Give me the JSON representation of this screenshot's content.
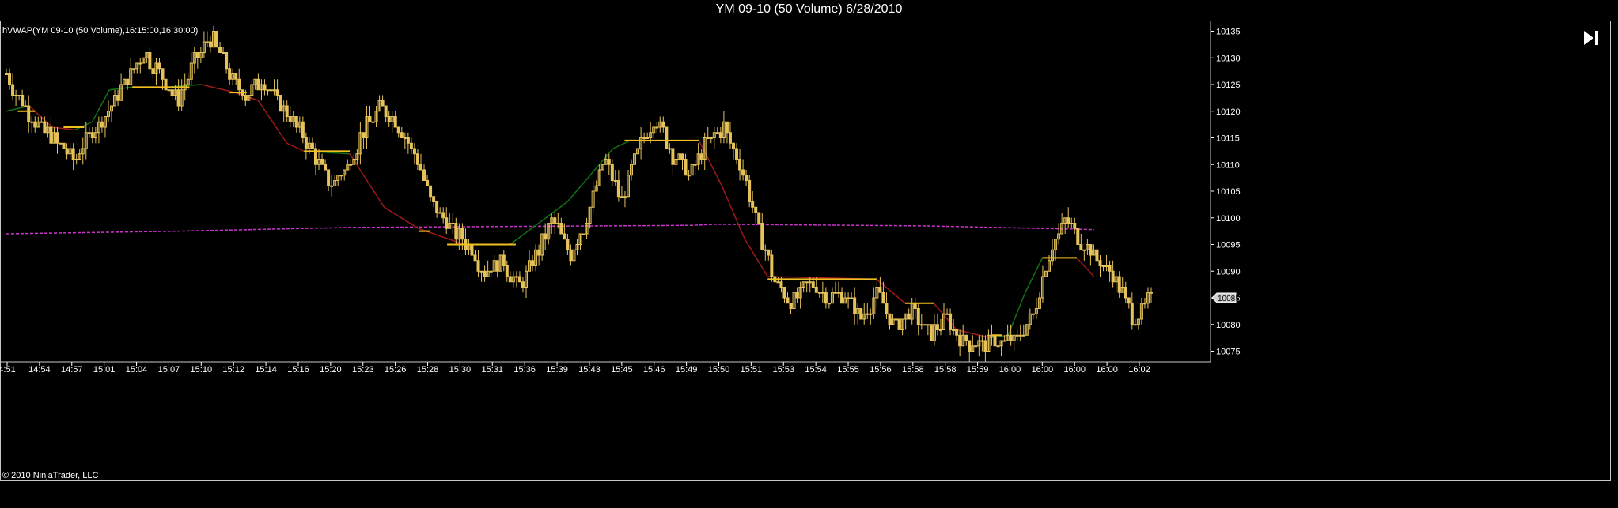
{
  "title": "YM 09-10 (50 Volume)  6/28/2010",
  "indicator_label": "hVWAP(YM 09-10 (50 Volume),16:15:00,16:30:00)",
  "copyright": "© 2010 NinjaTrader, LLC",
  "colors": {
    "background": "#000000",
    "candle": "#e6c35a",
    "level_line": "#f0c020",
    "trend_down": "#a01818",
    "trend_up": "#137013",
    "vwap": "#cc33cc"
  },
  "icons": {
    "skip_to_end": "skip-to-end-icon"
  },
  "chart_data": {
    "type": "candlestick",
    "title": "YM 09-10 (50 Volume)  6/28/2010",
    "ylim": [
      10073,
      10137
    ],
    "y_ticks": [
      10075,
      10080,
      10085,
      10090,
      10095,
      10100,
      10105,
      10110,
      10115,
      10120,
      10125,
      10130,
      10135
    ],
    "x_tick_labels": [
      "4:51",
      "14:54",
      "14:57",
      "15:01",
      "15:04",
      "15:07",
      "15:10",
      "15:12",
      "15:14",
      "15:16",
      "15:20",
      "15:23",
      "15:26",
      "15:28",
      "15:30",
      "15:31",
      "15:36",
      "15:39",
      "15:43",
      "15:45",
      "15:46",
      "15:49",
      "15:50",
      "15:51",
      "15:53",
      "15:54",
      "15:55",
      "15:56",
      "15:58",
      "15:58",
      "15:59",
      "16:00",
      "16:00",
      "16:00",
      "16:00",
      "16:02"
    ],
    "last_price_label": "10085",
    "last_price": 10085,
    "bar_count": 360,
    "close_path": [
      10127,
      10121,
      10117,
      10114,
      10111,
      10116,
      10120,
      10126,
      10131,
      10127,
      10122,
      10129,
      10134,
      10127,
      10123,
      10126,
      10121,
      10117,
      10112,
      10106,
      10110,
      10117,
      10121,
      10117,
      10111,
      10102,
      10098,
      10095,
      10090,
      10092,
      10087,
      10093,
      10100,
      10093,
      10100,
      10111,
      10103,
      10113,
      10119,
      10112,
      10108,
      10114,
      10117,
      10110,
      10098,
      10088,
      10084,
      10088,
      10085,
      10086,
      10081,
      10086,
      10079,
      10083,
      10078,
      10081,
      10077,
      10076,
      10077,
      10077,
      10081,
      10093,
      10100,
      10095,
      10092,
      10088,
      10081,
      10085
    ],
    "level_segments": [
      {
        "x0": 0.01,
        "x1": 0.025,
        "y": 10120
      },
      {
        "x0": 0.05,
        "x1": 0.068,
        "y": 10117
      },
      {
        "x0": 0.11,
        "x1": 0.16,
        "y": 10124.5
      },
      {
        "x0": 0.195,
        "x1": 0.21,
        "y": 10123.5
      },
      {
        "x0": 0.26,
        "x1": 0.3,
        "y": 10112.5
      },
      {
        "x0": 0.36,
        "x1": 0.37,
        "y": 10097.5
      },
      {
        "x0": 0.385,
        "x1": 0.445,
        "y": 10095
      },
      {
        "x0": 0.54,
        "x1": 0.605,
        "y": 10114.5
      },
      {
        "x0": 0.665,
        "x1": 0.76,
        "y": 10088.5
      },
      {
        "x0": 0.785,
        "x1": 0.81,
        "y": 10084
      },
      {
        "x0": 0.86,
        "x1": 0.87,
        "y": 10078
      },
      {
        "x0": 0.905,
        "x1": 0.935,
        "y": 10092.5
      }
    ],
    "trend_line": [
      {
        "x": 0.0,
        "y": 10120,
        "c": "up"
      },
      {
        "x": 0.02,
        "y": 10121,
        "c": "down"
      },
      {
        "x": 0.04,
        "y": 10117,
        "c": "down"
      },
      {
        "x": 0.06,
        "y": 10116.5,
        "c": "up"
      },
      {
        "x": 0.075,
        "y": 10118,
        "c": "up"
      },
      {
        "x": 0.09,
        "y": 10124,
        "c": "up"
      },
      {
        "x": 0.11,
        "y": 10124.5,
        "c": "up"
      },
      {
        "x": 0.14,
        "y": 10124.5,
        "c": "up"
      },
      {
        "x": 0.17,
        "y": 10125,
        "c": "down"
      },
      {
        "x": 0.2,
        "y": 10123.5,
        "c": "down"
      },
      {
        "x": 0.22,
        "y": 10122,
        "c": "down"
      },
      {
        "x": 0.245,
        "y": 10114,
        "c": "down"
      },
      {
        "x": 0.26,
        "y": 10112.5,
        "c": "up"
      },
      {
        "x": 0.3,
        "y": 10112,
        "c": "down"
      },
      {
        "x": 0.33,
        "y": 10102,
        "c": "down"
      },
      {
        "x": 0.36,
        "y": 10098,
        "c": "down"
      },
      {
        "x": 0.4,
        "y": 10095,
        "c": "up"
      },
      {
        "x": 0.44,
        "y": 10095,
        "c": "up"
      },
      {
        "x": 0.465,
        "y": 10099,
        "c": "up"
      },
      {
        "x": 0.49,
        "y": 10103,
        "c": "up"
      },
      {
        "x": 0.51,
        "y": 10108,
        "c": "up"
      },
      {
        "x": 0.53,
        "y": 10113,
        "c": "up"
      },
      {
        "x": 0.545,
        "y": 10114.5,
        "c": "up"
      },
      {
        "x": 0.605,
        "y": 10114.5,
        "c": "down"
      },
      {
        "x": 0.625,
        "y": 10106,
        "c": "down"
      },
      {
        "x": 0.645,
        "y": 10096,
        "c": "down"
      },
      {
        "x": 0.665,
        "y": 10089,
        "c": "down"
      },
      {
        "x": 0.76,
        "y": 10088.5,
        "c": "down"
      },
      {
        "x": 0.785,
        "y": 10084,
        "c": "down"
      },
      {
        "x": 0.81,
        "y": 10084,
        "c": "down"
      },
      {
        "x": 0.83,
        "y": 10079,
        "c": "down"
      },
      {
        "x": 0.86,
        "y": 10077.5,
        "c": "up"
      },
      {
        "x": 0.875,
        "y": 10078,
        "c": "up"
      },
      {
        "x": 0.89,
        "y": 10086,
        "c": "up"
      },
      {
        "x": 0.905,
        "y": 10092.5,
        "c": "down"
      },
      {
        "x": 0.935,
        "y": 10092.5,
        "c": "down"
      },
      {
        "x": 0.95,
        "y": 10089,
        "c": "down"
      }
    ],
    "vwap_line": [
      {
        "x": 0.0,
        "y": 10097
      },
      {
        "x": 0.15,
        "y": 10097.5
      },
      {
        "x": 0.3,
        "y": 10098.2
      },
      {
        "x": 0.45,
        "y": 10098.4
      },
      {
        "x": 0.6,
        "y": 10098.6
      },
      {
        "x": 0.62,
        "y": 10098.8
      },
      {
        "x": 0.8,
        "y": 10098.5
      },
      {
        "x": 0.95,
        "y": 10097.8
      }
    ]
  }
}
